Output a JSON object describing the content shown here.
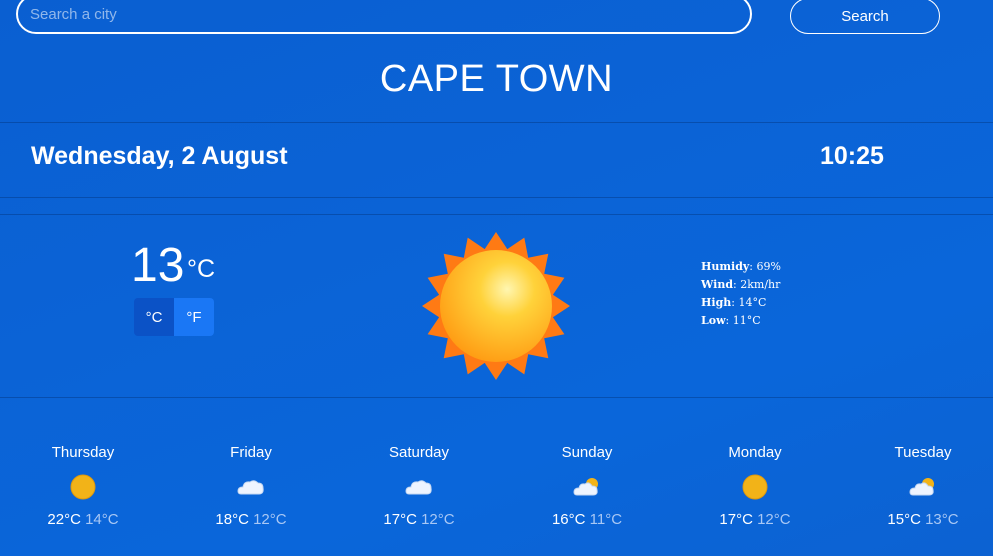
{
  "search": {
    "placeholder": "Search a city",
    "button_label": "Search"
  },
  "city": "CAPE TOWN",
  "date": "Wednesday, 2 August",
  "time": "10:25",
  "current": {
    "temp": "13",
    "unit": "°C",
    "unit_c_label": "°C",
    "unit_f_label": "°F",
    "icon": "sun-icon"
  },
  "details": {
    "humidity_label": "Humidy",
    "humidity_value": "69%",
    "wind_label": "Wind",
    "wind_value": "2km/hr",
    "high_label": "High",
    "high_value": "14°C",
    "low_label": "Low",
    "low_value": "11°C"
  },
  "forecast": [
    {
      "day": "Thursday",
      "icon": "sun-icon",
      "high": "22°C",
      "low": "14°C"
    },
    {
      "day": "Friday",
      "icon": "cloud-icon",
      "high": "18°C",
      "low": "12°C"
    },
    {
      "day": "Saturday",
      "icon": "cloud-icon",
      "high": "17°C",
      "low": "12°C"
    },
    {
      "day": "Sunday",
      "icon": "partly-cloudy-icon",
      "high": "16°C",
      "low": "11°C"
    },
    {
      "day": "Monday",
      "icon": "sun-icon",
      "high": "17°C",
      "low": "12°C"
    },
    {
      "day": "Tuesday",
      "icon": "partly-cloudy-icon",
      "high": "15°C",
      "low": "13°C"
    }
  ],
  "colors": {
    "accent": "#1a77f5",
    "background": "#0b63d6",
    "sun": "#ffb21a"
  }
}
